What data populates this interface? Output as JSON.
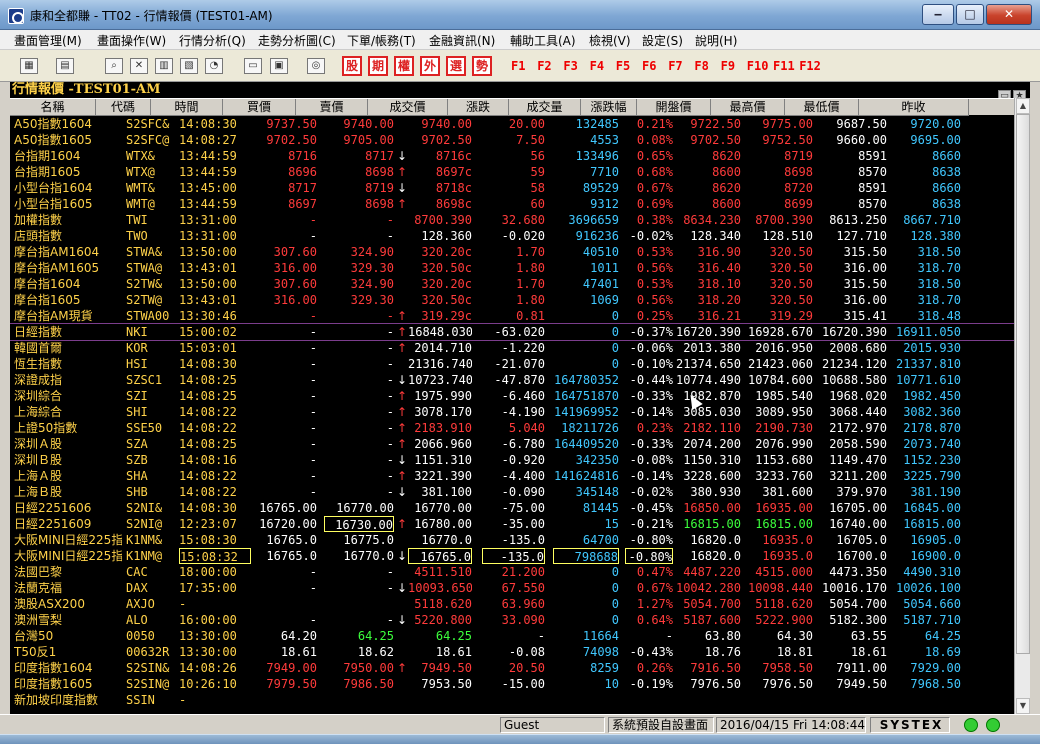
{
  "window": {
    "title": "康和全都賺 - TT02 - 行情報價 (TEST01-AM)",
    "min_label": "‒",
    "max_label": "□",
    "close_label": "✕"
  },
  "menus": [
    "畫面管理(M)",
    "畫面操作(W)",
    "行情分析(Q)",
    "走勢分析圖(C)",
    "下單/帳務(T)",
    "金融資訊(N)",
    "輔助工具(A)",
    "檢視(V)",
    "設定(S)",
    "說明(H)"
  ],
  "toolbar": {
    "icon_buttons": [
      "layout-icon",
      "monitor-icon",
      "zoom-icon",
      "close-window-icon",
      "tile-icon",
      "cascade-icon",
      "chart-icon",
      "card-icon",
      "print-icon",
      "logo-icon"
    ],
    "trade_keys": [
      "股",
      "期",
      "權",
      "外",
      "選",
      "勢"
    ],
    "fkeys": [
      "F1",
      "F2",
      "F3",
      "F4",
      "F5",
      "F6",
      "F7",
      "F8",
      "F9",
      "F10",
      "F11",
      "F12"
    ]
  },
  "panel": {
    "title": "行情報價 -TEST01-AM"
  },
  "table": {
    "headers": [
      "名稱",
      "代碼",
      "時間",
      "買價",
      "賣價",
      "成交價",
      "漲跌",
      "成交量",
      "漲跌幅",
      "開盤價",
      "最高價",
      "最低價",
      "昨收"
    ],
    "rows": [
      [
        "A50指數1604",
        "S2SFC&",
        "14:08:30",
        "9737.50",
        "9740.00",
        "",
        "9740.00",
        "20.00",
        "132485",
        "0.21%",
        "9722.50",
        "9775.00",
        "9687.50",
        "9720.00"
      ],
      [
        "A50指數1605",
        "S2SFC@",
        "14:08:27",
        "9702.50",
        "9705.00",
        "",
        "9702.50",
        "7.50",
        "4553",
        "0.08%",
        "9702.50",
        "9752.50",
        "9660.00",
        "9695.00"
      ],
      [
        "台指期1604",
        "WTX&",
        "13:44:59",
        "8716",
        "8717",
        "↓",
        "8716c",
        "56",
        "133496",
        "0.65%",
        "8620",
        "8719",
        "8591",
        "8660"
      ],
      [
        "台指期1605",
        "WTX@",
        "13:44:59",
        "8696",
        "8698",
        "↑",
        "8697c",
        "59",
        "7710",
        "0.68%",
        "8600",
        "8698",
        "8570",
        "8638"
      ],
      [
        "小型台指1604",
        "WMT&",
        "13:45:00",
        "8717",
        "8719",
        "↓",
        "8718c",
        "58",
        "89529",
        "0.67%",
        "8620",
        "8720",
        "8591",
        "8660"
      ],
      [
        "小型台指1605",
        "WMT@",
        "13:44:59",
        "8697",
        "8698",
        "↑",
        "8698c",
        "60",
        "9312",
        "0.69%",
        "8600",
        "8699",
        "8570",
        "8638"
      ],
      [
        "加權指數",
        "TWI",
        "13:31:00",
        "-",
        "-",
        "",
        "8700.390",
        "32.680",
        "3696659",
        "0.38%",
        "8634.230",
        "8700.390",
        "8613.250",
        "8667.710"
      ],
      [
        "店頭指數",
        "TWO",
        "13:31:00",
        "-",
        "-",
        "",
        "128.360",
        "-0.020",
        "916236",
        "-0.02%",
        "128.340",
        "128.510",
        "127.710",
        "128.380"
      ],
      [
        "摩台指AM1604",
        "STWA&",
        "13:50:00",
        "307.60",
        "324.90",
        "",
        "320.20c",
        "1.70",
        "40510",
        "0.53%",
        "316.90",
        "320.50",
        "315.50",
        "318.50"
      ],
      [
        "摩台指AM1605",
        "STWA@",
        "13:43:01",
        "316.00",
        "329.30",
        "",
        "320.50c",
        "1.80",
        "1011",
        "0.56%",
        "316.40",
        "320.50",
        "316.00",
        "318.70"
      ],
      [
        "摩台指1604",
        "S2TW&",
        "13:50:00",
        "307.60",
        "324.90",
        "",
        "320.20c",
        "1.70",
        "47401",
        "0.53%",
        "318.10",
        "320.50",
        "315.50",
        "318.50"
      ],
      [
        "摩台指1605",
        "S2TW@",
        "13:43:01",
        "316.00",
        "329.30",
        "",
        "320.50c",
        "1.80",
        "1069",
        "0.56%",
        "318.20",
        "320.50",
        "316.00",
        "318.70"
      ],
      [
        "摩台指AM現貨",
        "STWA00",
        "13:30:46",
        "-",
        "-",
        "↑",
        "319.29c",
        "0.81",
        "0",
        "0.25%",
        "316.21",
        "319.29",
        "315.41",
        "318.48"
      ],
      [
        "日經指數",
        "NKI",
        "15:00:02",
        "-",
        "-",
        "↑",
        "16848.030",
        "-63.020",
        "0",
        "-0.37%",
        "16720.390",
        "16928.670",
        "16720.390",
        "16911.050"
      ],
      [
        "韓國首爾",
        "KOR",
        "15:03:01",
        "-",
        "-",
        "↑",
        "2014.710",
        "-1.220",
        "0",
        "-0.06%",
        "2013.380",
        "2016.950",
        "2008.680",
        "2015.930"
      ],
      [
        "恆生指數",
        "HSI",
        "14:08:30",
        "-",
        "-",
        "",
        "21316.740",
        "-21.070",
        "0",
        "-0.10%",
        "21374.650",
        "21423.060",
        "21234.120",
        "21337.810"
      ],
      [
        "深證成指",
        "SZSC1",
        "14:08:25",
        "-",
        "-",
        "↓",
        "10723.740",
        "-47.870",
        "164780352",
        "-0.44%",
        "10774.490",
        "10784.600",
        "10688.580",
        "10771.610"
      ],
      [
        "深圳綜合",
        "SZI",
        "14:08:25",
        "-",
        "-",
        "↑",
        "1975.990",
        "-6.460",
        "164751870",
        "-0.33%",
        "1982.870",
        "1985.540",
        "1968.020",
        "1982.450"
      ],
      [
        "上海綜合",
        "SHI",
        "14:08:22",
        "-",
        "-",
        "↑",
        "3078.170",
        "-4.190",
        "141969952",
        "-0.14%",
        "3085.030",
        "3089.950",
        "3068.440",
        "3082.360"
      ],
      [
        "上證50指數",
        "SSE50",
        "14:08:22",
        "-",
        "-",
        "↑",
        "2183.910",
        "5.040",
        "18211726",
        "0.23%",
        "2182.110",
        "2190.730",
        "2172.970",
        "2178.870"
      ],
      [
        "深圳Ａ股",
        "SZA",
        "14:08:25",
        "-",
        "-",
        "↑",
        "2066.960",
        "-6.780",
        "164409520",
        "-0.33%",
        "2074.200",
        "2076.990",
        "2058.590",
        "2073.740"
      ],
      [
        "深圳Ｂ股",
        "SZB",
        "14:08:16",
        "-",
        "-",
        "↓",
        "1151.310",
        "-0.920",
        "342350",
        "-0.08%",
        "1150.310",
        "1153.680",
        "1149.470",
        "1152.230"
      ],
      [
        "上海Ａ股",
        "SHA",
        "14:08:22",
        "-",
        "-",
        "↑",
        "3221.390",
        "-4.400",
        "141624816",
        "-0.14%",
        "3228.600",
        "3233.760",
        "3211.200",
        "3225.790"
      ],
      [
        "上海Ｂ股",
        "SHB",
        "14:08:22",
        "-",
        "-",
        "↓",
        "381.100",
        "-0.090",
        "345148",
        "-0.02%",
        "380.930",
        "381.600",
        "379.970",
        "381.190"
      ],
      [
        "日經2251606",
        "S2NI&",
        "14:08:30",
        "16765.00",
        "16770.00",
        "",
        "16770.00",
        "-75.00",
        "81445",
        "-0.45%",
        "16850.00",
        "16935.00",
        "16705.00",
        "16845.00"
      ],
      [
        "日經2251609",
        "S2NI@",
        "12:23:07",
        "16720.00",
        "16730.00",
        "↑",
        "16780.00",
        "-35.00",
        "15",
        "-0.21%",
        "16815.00",
        "16815.00",
        "16740.00",
        "16815.00"
      ],
      [
        "大阪MINI日經225指數",
        "K1NM&",
        "15:08:30",
        "16765.0",
        "16775.0",
        "",
        "16770.0",
        "-135.0",
        "64700",
        "-0.80%",
        "16820.0",
        "16935.0",
        "16705.0",
        "16905.0"
      ],
      [
        "大阪MINI日經225指數",
        "K1NM@",
        "15:08:32",
        "16765.0",
        "16770.0",
        "↓",
        "16765.0",
        "-135.0",
        "798688",
        "-0.80%",
        "16820.0",
        "16935.0",
        "16700.0",
        "16900.0"
      ],
      [
        "法國巴黎",
        "CAC",
        "18:00:00",
        "-",
        "-",
        "",
        "4511.510",
        "21.200",
        "0",
        "0.47%",
        "4487.220",
        "4515.000",
        "4473.350",
        "4490.310"
      ],
      [
        "法蘭克福",
        "DAX",
        "17:35:00",
        "-",
        "-",
        "↓",
        "10093.650",
        "67.550",
        "0",
        "0.67%",
        "10042.280",
        "10098.440",
        "10016.170",
        "10026.100"
      ],
      [
        "澳股ASX200",
        "AXJO",
        "-",
        "",
        "",
        "",
        "5118.620",
        "63.960",
        "0",
        "1.27%",
        "5054.700",
        "5118.620",
        "5054.700",
        "5054.660"
      ],
      [
        "澳洲雪梨",
        "ALO",
        "16:00:00",
        "-",
        "-",
        "↓",
        "5220.800",
        "33.090",
        "0",
        "0.64%",
        "5187.600",
        "5222.900",
        "5182.300",
        "5187.710"
      ],
      [
        "台灣50",
        "0050",
        "13:30:00",
        "64.20",
        "64.25",
        "",
        "64.25",
        "-",
        "11664",
        "-",
        "63.80",
        "64.30",
        "63.55",
        "64.25"
      ],
      [
        "T50反1",
        "00632R",
        "13:30:00",
        "18.61",
        "18.62",
        "",
        "18.61",
        "-0.08",
        "74098",
        "-0.43%",
        "18.76",
        "18.81",
        "18.61",
        "18.69"
      ],
      [
        "印度指數1604",
        "S2SIN&",
        "14:08:26",
        "7949.00",
        "7950.00",
        "↑",
        "7949.50",
        "20.50",
        "8259",
        "0.26%",
        "7916.50",
        "7958.50",
        "7911.00",
        "7929.00"
      ],
      [
        "印度指數1605",
        "S2SIN@",
        "10:26:10",
        "7979.50",
        "7986.50",
        "",
        "7953.50",
        "-15.00",
        "10",
        "-0.19%",
        "7976.50",
        "7976.50",
        "7949.50",
        "7968.50"
      ],
      [
        "新加坡印度指數",
        "SSIN",
        "-",
        "",
        "",
        "",
        "",
        "",
        "",
        "",
        "",
        "",
        "",
        ""
      ]
    ]
  },
  "colors": {
    "up": "#ff3b3b",
    "down": "#ffffff",
    "flat": "#ffffff",
    "name": "#ffd24a",
    "code": "#ffd24a",
    "time": "#ffd24a",
    "vol": "#41c8ff",
    "green": "#3cff3c"
  },
  "status": {
    "user": "Guest",
    "blank": "",
    "mode": "系統預設自設畫面",
    "datetime": "2016/04/15 Fri 14:08:44",
    "brand": "SYSTEX"
  }
}
